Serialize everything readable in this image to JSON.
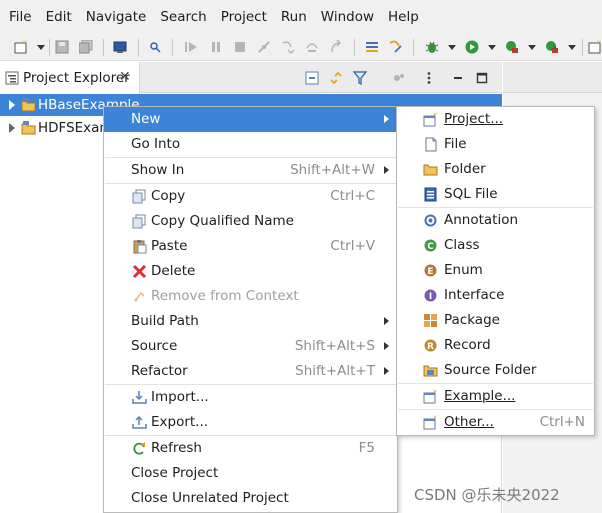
{
  "menubar": {
    "items": [
      "File",
      "Edit",
      "Navigate",
      "Search",
      "Project",
      "Run",
      "Window",
      "Help"
    ]
  },
  "toolbar": {
    "icons": [
      "new-wizard-icon",
      "save-icon",
      "save-all-icon",
      "terminal-icon",
      "debug-skip-icon",
      "resume-icon",
      "suspend-icon",
      "terminate-icon",
      "disconnect-icon",
      "step-into-icon",
      "step-over-icon",
      "step-return-icon",
      "drop-to-frame-icon",
      "use-step-filters-icon",
      "debug-icon",
      "run-icon",
      "coverage-icon",
      "external-tools-icon",
      "new-java-package-icon"
    ]
  },
  "explorer": {
    "title": "Project Explorer",
    "close_glyph": "✕",
    "projects": [
      {
        "label": "HBaseExample",
        "selected": true
      },
      {
        "label": "HDFSExample",
        "selected": false
      }
    ]
  },
  "context_menu": {
    "items": [
      {
        "label": "New",
        "accel": "",
        "submenu": true,
        "icon": "",
        "active": true
      },
      {
        "label": "Go Into",
        "accel": "",
        "submenu": false,
        "icon": ""
      },
      {
        "label": "Show In",
        "accel": "Shift+Alt+W",
        "submenu": true,
        "icon": ""
      },
      {
        "label": "Copy",
        "accel": "Ctrl+C",
        "submenu": false,
        "icon": "copy-icon"
      },
      {
        "label": "Copy Qualified Name",
        "accel": "",
        "submenu": false,
        "icon": "copy-qualified-name-icon"
      },
      {
        "label": "Paste",
        "accel": "Ctrl+V",
        "submenu": false,
        "icon": "paste-icon"
      },
      {
        "label": "Delete",
        "accel": "",
        "submenu": false,
        "icon": "delete-icon"
      },
      {
        "label": "Remove from Context",
        "accel": "",
        "submenu": false,
        "icon": "remove-from-context-icon",
        "disabled": true
      },
      {
        "label": "Build Path",
        "accel": "",
        "submenu": true,
        "icon": ""
      },
      {
        "label": "Source",
        "accel": "Shift+Alt+S",
        "submenu": true,
        "icon": ""
      },
      {
        "label": "Refactor",
        "accel": "Shift+Alt+T",
        "submenu": true,
        "icon": ""
      },
      {
        "label": "Import...",
        "accel": "",
        "submenu": false,
        "icon": "import-icon"
      },
      {
        "label": "Export...",
        "accel": "",
        "submenu": false,
        "icon": "export-icon"
      },
      {
        "label": "Refresh",
        "accel": "F5",
        "submenu": false,
        "icon": "refresh-icon"
      },
      {
        "label": "Close Project",
        "accel": "",
        "submenu": false,
        "icon": ""
      },
      {
        "label": "Close Unrelated Project",
        "accel": "",
        "submenu": false,
        "icon": ""
      }
    ]
  },
  "submenu": {
    "items": [
      {
        "label": "Project...",
        "accel": "",
        "icon": "new-project-icon"
      },
      {
        "label": "File",
        "accel": "",
        "icon": "file-icon"
      },
      {
        "label": "Folder",
        "accel": "",
        "icon": "folder-icon"
      },
      {
        "label": "SQL File",
        "accel": "",
        "icon": "sql-file-icon"
      },
      {
        "label": "Annotation",
        "accel": "",
        "icon": "annotation-icon"
      },
      {
        "label": "Class",
        "accel": "",
        "icon": "class-icon"
      },
      {
        "label": "Enum",
        "accel": "",
        "icon": "enum-icon"
      },
      {
        "label": "Interface",
        "accel": "",
        "icon": "interface-icon"
      },
      {
        "label": "Package",
        "accel": "",
        "icon": "package-icon"
      },
      {
        "label": "Record",
        "accel": "",
        "icon": "record-icon"
      },
      {
        "label": "Source Folder",
        "accel": "",
        "icon": "source-folder-icon"
      },
      {
        "label": "Example...",
        "accel": "",
        "icon": "example-icon"
      },
      {
        "label": "Other...",
        "accel": "Ctrl+N",
        "icon": "other-wizard-icon"
      }
    ]
  },
  "watermark": "CSDN @乐未央2022",
  "colors": {
    "selection": "#3c84d6",
    "menu_bg": "#ffffff",
    "chrome_bg": "#f0f0f0",
    "disabled_text": "#a0a0a0",
    "accel_text": "#8c8c8c"
  }
}
